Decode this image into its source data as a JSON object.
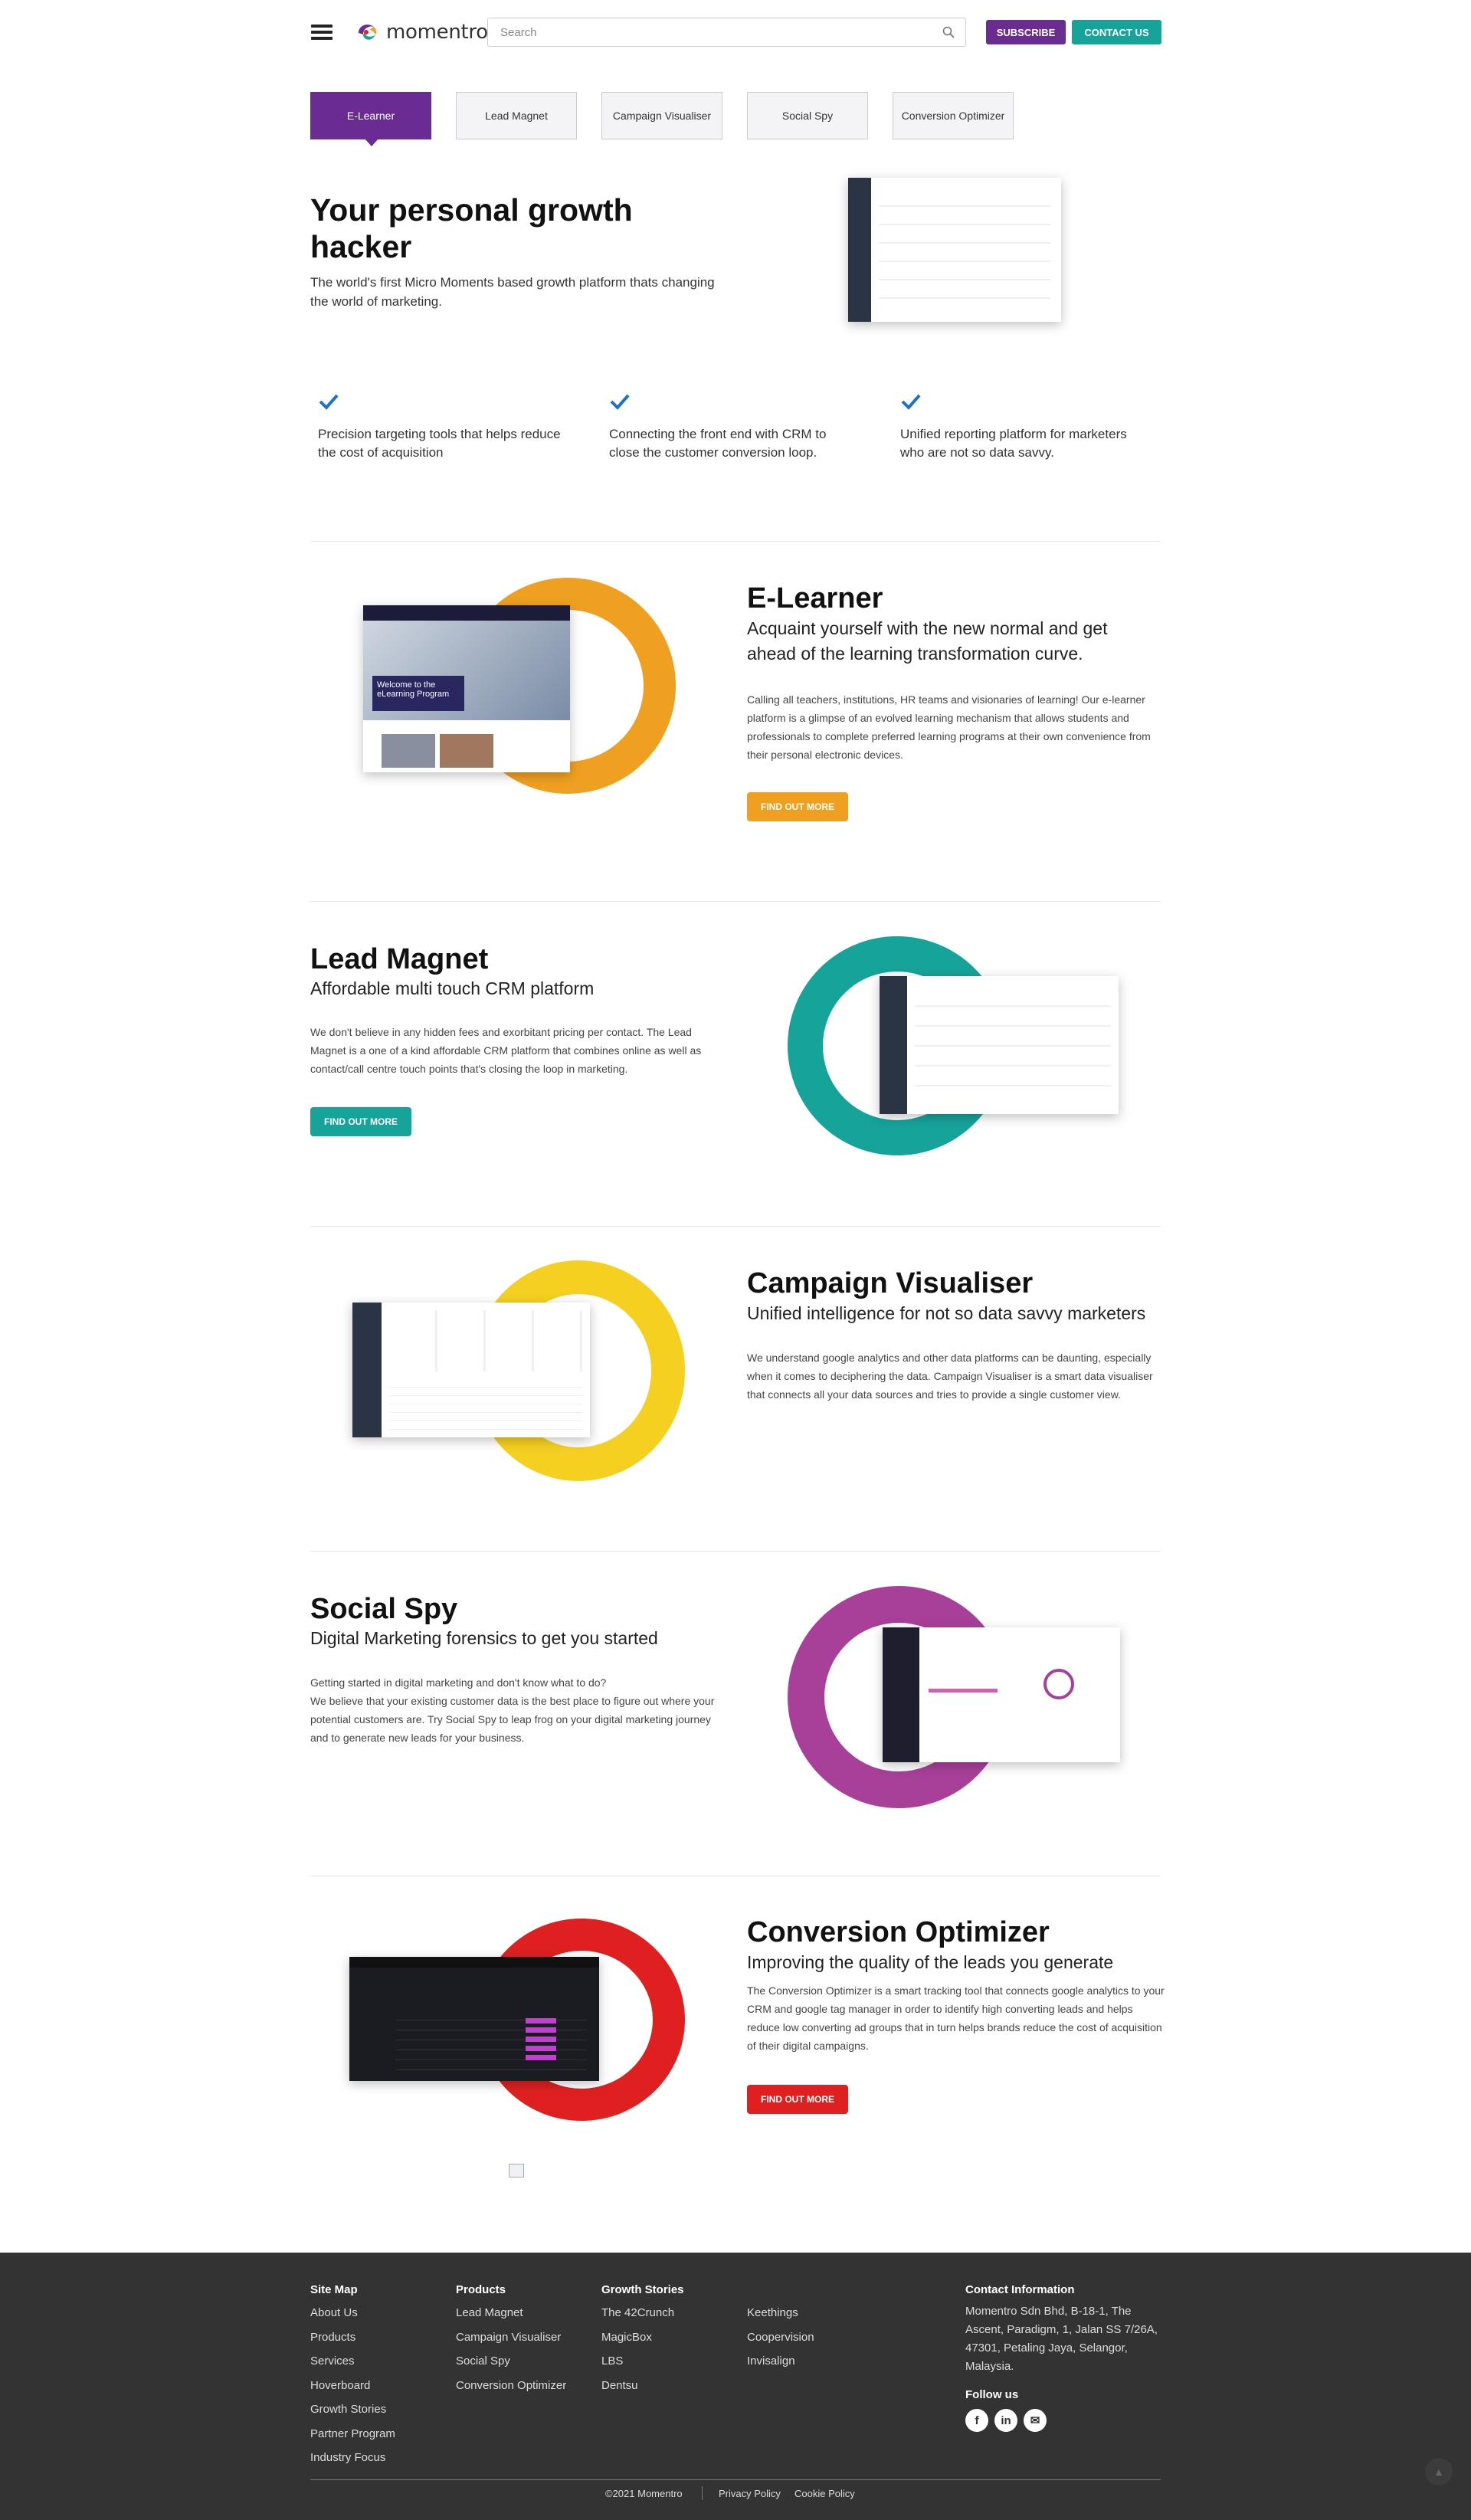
{
  "header": {
    "logo_text": "momentro",
    "search_placeholder": "Search",
    "subscribe_label": "SUBSCRIBE",
    "contact_label": "CONTACT US"
  },
  "tabs": [
    {
      "label": "E-Learner",
      "active": true
    },
    {
      "label": "Lead Magnet",
      "active": false
    },
    {
      "label": "Campaign Visualiser",
      "active": false
    },
    {
      "label": "Social Spy",
      "active": false
    },
    {
      "label": "Conversion Optimizer",
      "active": false
    }
  ],
  "hero": {
    "title": "Your personal growth hacker",
    "subtitle": "The world's first Micro Moments based growth platform thats changing the world of marketing."
  },
  "features": [
    {
      "text": "Precision targeting tools that helps reduce the cost of acquisition"
    },
    {
      "text": "Connecting the front end with CRM to close the customer conversion loop."
    },
    {
      "text": "Unified reporting platform for marketers who are not so data savvy."
    }
  ],
  "products": [
    {
      "title": "E-Learner",
      "subtitle": "Acquaint yourself with the new normal and get ahead of the learning transformation curve.",
      "body": "Calling all teachers, institutions, HR teams and visionaries of learning! Our e-learner platform is a glimpse of an evolved learning mechanism that allows students and professionals to complete preferred learning programs at their own convenience from their personal electronic devices.",
      "cta": "FIND OUT MORE",
      "color": "#f0a020",
      "screen_text": "Welcome to the eLearning Program"
    },
    {
      "title": "Lead Magnet",
      "subtitle": "Affordable multi touch CRM platform",
      "body": "We don't believe in any hidden fees and exorbitant pricing per contact. The Lead Magnet is a one of a kind affordable CRM platform that combines online as well as contact/call centre touch points that's closing the loop in marketing.",
      "cta": "FIND OUT MORE",
      "color": "#16a39a"
    },
    {
      "title": "Campaign Visualiser",
      "subtitle": "Unified intelligence for not so data savvy marketers",
      "body": "We understand google analytics and other data platforms can be daunting, especially when it comes to deciphering the data. Campaign Visualiser is a smart data visualiser that connects all your data sources and tries to provide a single customer view.",
      "color": "#f5d020"
    },
    {
      "title": "Social Spy",
      "subtitle": "Digital Marketing forensics to get you started",
      "body": "Getting started in digital marketing and don't know what to do?\nWe believe that your existing customer data is the best place to figure out where your potential customers are. Try Social Spy to leap frog on your digital marketing journey and to generate new leads for your business.",
      "color": "#a8409a"
    },
    {
      "title": "Conversion Optimizer",
      "subtitle": "Improving the quality of the leads you generate",
      "body": "The Conversion Optimizer is a smart tracking tool that connects google analytics to your CRM and google tag manager in order to identify high converting leads and helps reduce low converting ad groups that in turn helps brands reduce the cost of acquisition of their digital campaigns.",
      "cta": "FIND OUT MORE",
      "color": "#e02020"
    }
  ],
  "footer": {
    "sitemap": {
      "heading": "Site Map",
      "links": [
        "About Us",
        "Products",
        "Services",
        "Hoverboard",
        "Growth Stories",
        "Partner Program",
        "Industry Focus"
      ]
    },
    "products": {
      "heading": "Products",
      "links": [
        "Lead Magnet",
        "Campaign Visualiser",
        "Social Spy",
        "Conversion Optimizer"
      ]
    },
    "growth": {
      "heading": "Growth Stories",
      "links": [
        "The 42Crunch",
        "MagicBox",
        "LBS",
        "Dentsu"
      ]
    },
    "growth2": {
      "links": [
        "Keethings",
        "Coopervision",
        "Invisalign"
      ]
    },
    "contact": {
      "heading": "Contact Information",
      "address": "Momentro Sdn Bhd, B-18-1, The Ascent, Paradigm, 1, Jalan SS 7/26A, 47301, Petaling Jaya, Selangor, Malaysia."
    },
    "follow": {
      "heading": "Follow us",
      "icons": [
        "facebook-icon",
        "linkedin-icon",
        "email-icon"
      ]
    },
    "copyright": "©2021 Momentro",
    "privacy": "Privacy Policy",
    "cookie": "Cookie Policy"
  }
}
